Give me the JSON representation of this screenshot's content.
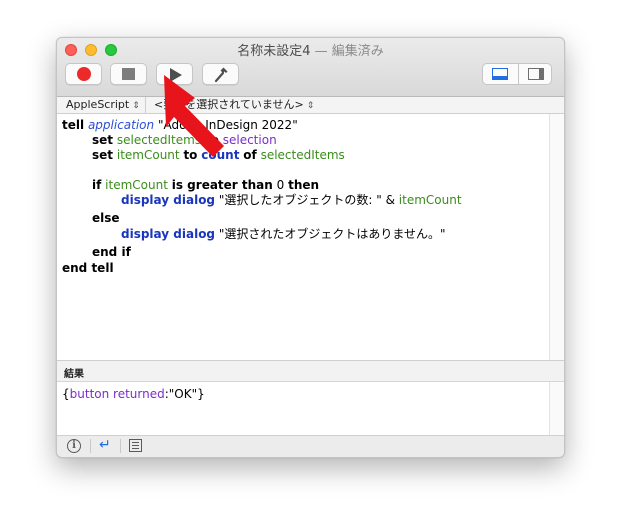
{
  "window": {
    "title": "名称未設定4",
    "edited_suffix": "— 編集済み"
  },
  "toolbar": {
    "record_label": "record",
    "stop_label": "stop",
    "run_label": "run",
    "compile_label": "compile"
  },
  "navbar": {
    "language": "AppleScript",
    "handler": "<要素を選択されていません>"
  },
  "code": {
    "line1": [
      "tell",
      "application",
      "\"Adobe InDesign 2022\""
    ],
    "line2": [
      "set",
      "selectedItems",
      "to",
      "selection"
    ],
    "line3": [
      "set",
      "itemCount",
      "to",
      "count",
      "of",
      "selectedItems"
    ],
    "line5": [
      "if",
      "itemCount",
      "is greater than",
      "0",
      "then"
    ],
    "line6": [
      "display dialog",
      "\"選択したオブジェクトの数: \"",
      "&",
      "itemCount"
    ],
    "line7": [
      "else"
    ],
    "line8": [
      "display dialog",
      "\"選択されたオブジェクトはありません。\""
    ],
    "line9": [
      "end if"
    ],
    "line10": [
      "end tell"
    ]
  },
  "result_pane": {
    "label": "結果",
    "open_brace": "{",
    "key": "button returned",
    "colon": ":",
    "value": "\"OK\"",
    "close_brace": "}"
  },
  "bottom": {
    "info_glyph": "i",
    "return_glyph": "↵"
  },
  "colors": {
    "record": "#ec2a2a",
    "accent": "#1f6fe0",
    "arrow": "#e8141b",
    "variable": "#3a8d1b",
    "command": "#1936bc",
    "property": "#7b2dcc"
  }
}
